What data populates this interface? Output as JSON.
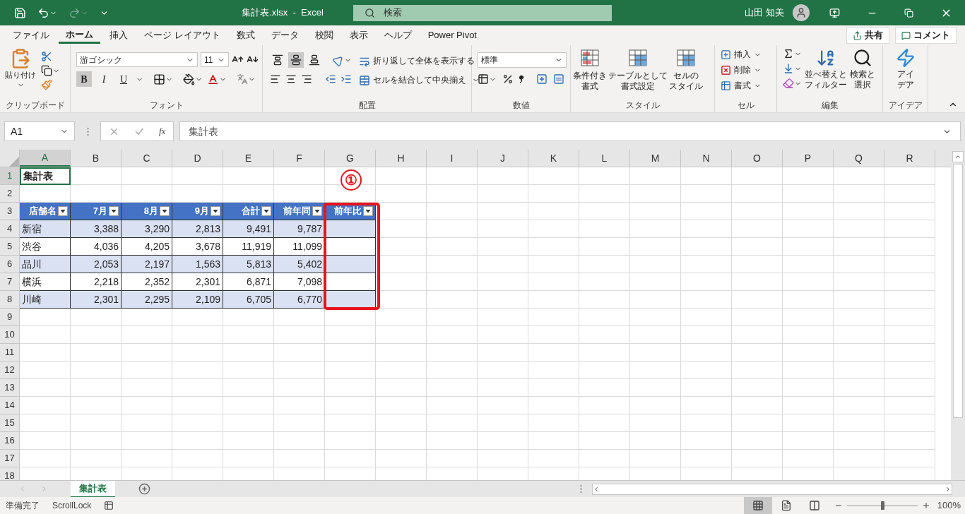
{
  "title_bar": {
    "title": "集計表.xlsx  -  Excel",
    "search_placeholder": "検索",
    "user_name": "山田 知美"
  },
  "menu_tabs": [
    {
      "label": "ファイル",
      "selected": false
    },
    {
      "label": "ホーム",
      "selected": true
    },
    {
      "label": "挿入",
      "selected": false
    },
    {
      "label": "ページ レイアウト",
      "selected": false
    },
    {
      "label": "数式",
      "selected": false
    },
    {
      "label": "データ",
      "selected": false
    },
    {
      "label": "校閲",
      "selected": false
    },
    {
      "label": "表示",
      "selected": false
    },
    {
      "label": "ヘルプ",
      "selected": false
    },
    {
      "label": "Power Pivot",
      "selected": false
    }
  ],
  "share_button": "共有",
  "comment_button": "コメント",
  "ribbon": {
    "clipboard": {
      "paste": "貼り付け",
      "label": "クリップボード"
    },
    "font": {
      "font_name": "游ゴシック",
      "font_size": "11",
      "style_buttons": [
        {
          "label": "B",
          "selected": true
        },
        {
          "label": "I",
          "selected": false
        },
        {
          "label": "U",
          "selected": false
        }
      ],
      "label": "フォント"
    },
    "alignment": {
      "vertical_align": [
        {
          "kind": "top",
          "selected": false
        },
        {
          "kind": "middle",
          "selected": true
        },
        {
          "kind": "bottom",
          "selected": false
        }
      ],
      "wrap_text": "折り返して全体を表示する",
      "merge_center": "セルを結合して中央揃え",
      "label": "配置"
    },
    "number": {
      "format": "標準",
      "label": "数値"
    },
    "styles": {
      "buttons": [
        {
          "lines": [
            "条件付き",
            "書式"
          ]
        },
        {
          "lines": [
            "テーブルとして",
            "書式設定"
          ]
        },
        {
          "lines": [
            "セルの",
            "スタイル"
          ]
        }
      ],
      "label": "スタイル"
    },
    "cells": {
      "buttons": [
        "挿入",
        "削除",
        "書式"
      ],
      "label": "セル"
    },
    "editing": {
      "buttons": [
        {
          "lines": [
            "並べ替えと",
            "フィルター"
          ]
        },
        {
          "lines": [
            "検索と",
            "選択"
          ]
        }
      ],
      "label": "編集"
    },
    "ideas": {
      "lines": [
        "アイ",
        "デア"
      ],
      "label": "アイデア"
    }
  },
  "formula_bar": {
    "name_box": "A1",
    "function_label": "fx",
    "value": "集計表"
  },
  "columns": [
    {
      "label": "A",
      "selected": true
    },
    {
      "label": "B",
      "selected": false
    },
    {
      "label": "C",
      "selected": false
    },
    {
      "label": "D",
      "selected": false
    },
    {
      "label": "E",
      "selected": false
    },
    {
      "label": "F",
      "selected": false
    },
    {
      "label": "G",
      "selected": false
    },
    {
      "label": "H",
      "selected": false
    },
    {
      "label": "I",
      "selected": false
    },
    {
      "label": "J",
      "selected": false
    },
    {
      "label": "K",
      "selected": false
    },
    {
      "label": "L",
      "selected": false
    },
    {
      "label": "M",
      "selected": false
    },
    {
      "label": "N",
      "selected": false
    },
    {
      "label": "O",
      "selected": false
    },
    {
      "label": "P",
      "selected": false
    },
    {
      "label": "Q",
      "selected": false
    },
    {
      "label": "R",
      "selected": false
    }
  ],
  "row_numbers": [
    {
      "label": "1",
      "selected": true
    },
    {
      "label": "2",
      "selected": false
    },
    {
      "label": "3",
      "selected": false
    },
    {
      "label": "4",
      "selected": false
    },
    {
      "label": "5",
      "selected": false
    },
    {
      "label": "6",
      "selected": false
    },
    {
      "label": "7",
      "selected": false
    },
    {
      "label": "8",
      "selected": false
    },
    {
      "label": "9",
      "selected": false
    },
    {
      "label": "10",
      "selected": false
    },
    {
      "label": "11",
      "selected": false
    },
    {
      "label": "12",
      "selected": false
    },
    {
      "label": "13",
      "selected": false
    },
    {
      "label": "14",
      "selected": false
    },
    {
      "label": "15",
      "selected": false
    },
    {
      "label": "16",
      "selected": false
    },
    {
      "label": "17",
      "selected": false
    },
    {
      "label": "18",
      "selected": false
    }
  ],
  "title_cell": "集計表",
  "table": {
    "headers": [
      "店舗名",
      "7月",
      "8月",
      "9月",
      "合計",
      "前年同",
      "前年比"
    ],
    "rows": [
      {
        "banded": true,
        "cells": [
          "新宿",
          "3,388",
          "3,290",
          "2,813",
          "9,491",
          "9,787"
        ]
      },
      {
        "banded": false,
        "cells": [
          "渋谷",
          "4,036",
          "4,205",
          "3,678",
          "11,919",
          "11,099"
        ]
      },
      {
        "banded": true,
        "cells": [
          "品川",
          "2,053",
          "2,197",
          "1,563",
          "5,813",
          "5,402"
        ]
      },
      {
        "banded": false,
        "cells": [
          "横浜",
          "2,218",
          "2,352",
          "2,301",
          "6,871",
          "7,098"
        ]
      },
      {
        "banded": true,
        "cells": [
          "川崎",
          "2,301",
          "2,295",
          "2,109",
          "6,705",
          "6,770"
        ]
      }
    ]
  },
  "annotation": {
    "label": "①"
  },
  "sheet_tabs": [
    {
      "label": "集計表",
      "selected": true
    }
  ],
  "status_bar": {
    "mode": "準備完了",
    "scroll_lock": "ScrollLock",
    "views": [
      {
        "kind": "normal",
        "selected": true
      },
      {
        "kind": "page_layout",
        "selected": false
      },
      {
        "kind": "page_break",
        "selected": false
      }
    ],
    "zoom": {
      "level": 0.5,
      "reading": "100%"
    }
  }
}
